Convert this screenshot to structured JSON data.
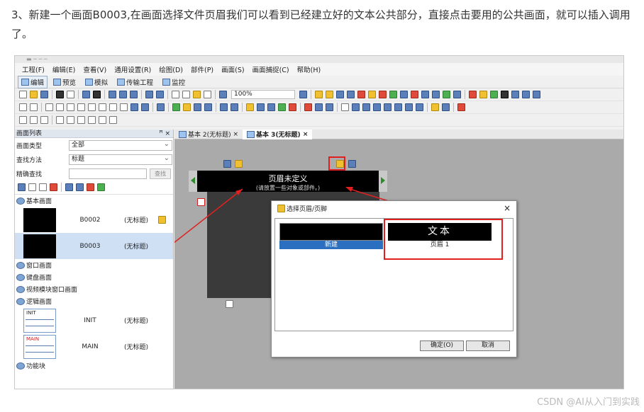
{
  "instruction": "3、新建一个画面B0003,在画面选择文件页眉我们可以看到已经建立好的文本公共部分，直接点击要用的公共画面，就可以插入调用了。",
  "menubar": [
    "工程(F)",
    "编辑(E)",
    "查看(V)",
    "通用设置(R)",
    "绘图(D)",
    "部件(P)",
    "画面(S)",
    "画面捕捉(C)",
    "帮助(H)"
  ],
  "modes": [
    "编辑",
    "预览",
    "模拟",
    "传输工程",
    "监控"
  ],
  "toolbar": {
    "zoom": "100%"
  },
  "leftpanel": {
    "title": "画面列表",
    "pin": "ꟸ ×",
    "type_label": "画面类型",
    "type_value": "全部",
    "search_label": "查找方法",
    "search_value": "标题",
    "exact_label": "精确查找",
    "search_button": "查找",
    "categories": {
      "basic": "基本画面",
      "window": "窗口画面",
      "keyboard": "键盘画面",
      "video": "视频模块窗口画面",
      "logic": "逻辑画面",
      "function": "功能块"
    },
    "basic_items": [
      {
        "name": "B0002",
        "title": "(无标题)"
      },
      {
        "name": "B0003",
        "title": "(无标题)"
      }
    ],
    "logic_items": [
      {
        "name": "INIT",
        "title": "(无标题)",
        "tag": "INIT"
      },
      {
        "name": "MAIN",
        "title": "(无标题)",
        "tag": "MAIN"
      }
    ]
  },
  "tabs": [
    {
      "label": "基本 2(无标题)",
      "close": "×"
    },
    {
      "label": "基本 3(无标题)",
      "close": "×"
    }
  ],
  "canvas": {
    "header_title": "页眉未定义",
    "header_sub": "(请放置一些对象或部件。)"
  },
  "dialog": {
    "title": "选择页眉/页脚",
    "close": "×",
    "options": [
      {
        "caption": "新建",
        "content": ""
      },
      {
        "caption": "页眉 1",
        "content": "文本"
      }
    ],
    "ok": "确定(O)",
    "cancel": "取消"
  },
  "watermark": "CSDN @AI从入门到实践",
  "colors": {
    "highlight": "#e02020",
    "selection": "#cfe0f5"
  }
}
